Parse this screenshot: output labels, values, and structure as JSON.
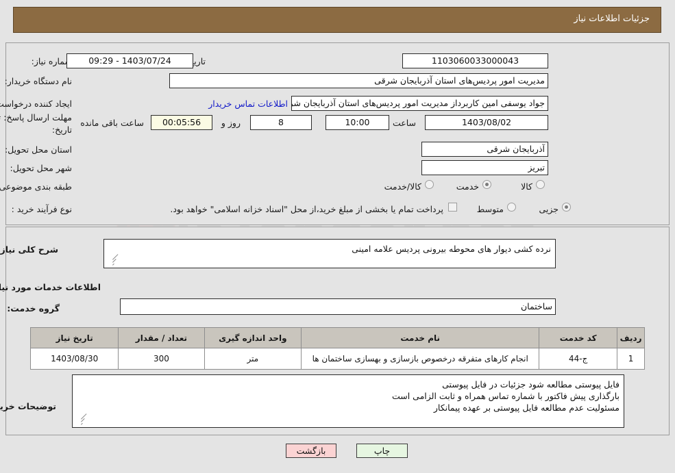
{
  "header": {
    "title": "جزئیات اطلاعات نیاز",
    "bar_color": "#8c6b42"
  },
  "form": {
    "need_number_label": "شماره نیاز:",
    "need_number_value": "1103060033000043",
    "announce_label": "تاریخ و ساعت اعلان عمومی:",
    "announce_value": "1403/07/24 - 09:29",
    "buyer_org_label": "نام دستگاه خریدار:",
    "buyer_org_value": "مدیریت امور پردیس‌های استان آذربایجان شرقی",
    "requester_label": "ایجاد کننده درخواست:",
    "requester_value": "جواد یوسفی امین کاربرداز مدیریت امور پردیس‌های استان آذربایجان شرقی",
    "contact_link": "اطلاعات تماس خریدار",
    "deadline_label_line1": "مهلت ارسال پاسخ: تا",
    "deadline_label_line2": "تاریخ:",
    "deadline_date": "1403/08/02",
    "time_label": "ساعت",
    "time_value": "10:00",
    "days_value": "8",
    "days_label": "روز و",
    "countdown_value": "00:05:56",
    "countdown_label": "ساعت باقی مانده",
    "province_label": "استان محل تحویل:",
    "province_value": "آذربایجان شرقی",
    "city_label": "شهر محل تحویل:",
    "city_value": "تبریز",
    "category_label": "طبقه بندی موضوعی:",
    "category_options": [
      "کالا",
      "خدمت",
      "کالا/خدمت"
    ],
    "category_selected": "خدمت",
    "process_label": "نوع فرآیند خرید :",
    "process_options": [
      "جزیی",
      "متوسط"
    ],
    "process_selected": "جزیی",
    "treasury_checkbox_text": "پرداخت تمام یا بخشی از مبلغ خرید،از محل \"اسناد خزانه اسلامی\" خواهد بود.",
    "treasury_checked": false
  },
  "middle": {
    "general_desc_label": "شرح کلی نیاز:",
    "general_desc_value": "نرده کشی دیوار های محوطه بیرونی پردیس علامه امینی",
    "services_info_heading": "اطلاعات خدمات مورد نیاز",
    "service_group_label": "گروه خدمت:",
    "service_group_value": "ساختمان",
    "buyer_notes_label": "توضیحات خریدار:",
    "buyer_notes_lines": [
      "فایل پیوستی مطالعه شود جزئیات در فایل پیوستی",
      "بارگذاری پیش فاکتور با شماره تماس همراه و ثابت الزامی است",
      "مسئولیت عدم مطالعه فایل پیوستی بر عهده پیمانکار"
    ]
  },
  "table": {
    "headers": [
      "ردیف",
      "کد خدمت",
      "نام خدمت",
      "واحد اندازه گیری",
      "تعداد / مقدار",
      "تاریخ نیاز"
    ],
    "rows": [
      {
        "row_no": "1",
        "service_code": "ج-44",
        "service_name": "انجام کارهای متفرقه درخصوص بازسازی و بهسازی ساختمان ها",
        "unit": "متر",
        "quantity": "300",
        "need_date": "1403/08/30"
      }
    ]
  },
  "footer": {
    "print_label": "چاپ",
    "back_label": "بازگشت",
    "print_color": "#e6f6e1",
    "back_color": "#fbd3d3"
  },
  "watermark": {
    "text": "AriaTender.net"
  }
}
